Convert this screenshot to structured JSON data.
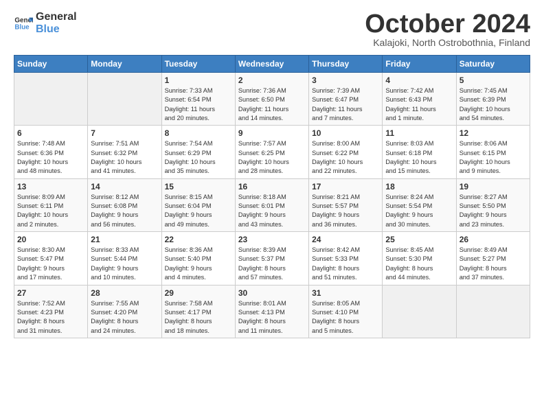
{
  "logo": {
    "line1": "General",
    "line2": "Blue"
  },
  "title": "October 2024",
  "subtitle": "Kalajoki, North Ostrobothnia, Finland",
  "days_header": [
    "Sunday",
    "Monday",
    "Tuesday",
    "Wednesday",
    "Thursday",
    "Friday",
    "Saturday"
  ],
  "weeks": [
    [
      {
        "num": "",
        "data": ""
      },
      {
        "num": "",
        "data": ""
      },
      {
        "num": "1",
        "data": "Sunrise: 7:33 AM\nSunset: 6:54 PM\nDaylight: 11 hours\nand 20 minutes."
      },
      {
        "num": "2",
        "data": "Sunrise: 7:36 AM\nSunset: 6:50 PM\nDaylight: 11 hours\nand 14 minutes."
      },
      {
        "num": "3",
        "data": "Sunrise: 7:39 AM\nSunset: 6:47 PM\nDaylight: 11 hours\nand 7 minutes."
      },
      {
        "num": "4",
        "data": "Sunrise: 7:42 AM\nSunset: 6:43 PM\nDaylight: 11 hours\nand 1 minute."
      },
      {
        "num": "5",
        "data": "Sunrise: 7:45 AM\nSunset: 6:39 PM\nDaylight: 10 hours\nand 54 minutes."
      }
    ],
    [
      {
        "num": "6",
        "data": "Sunrise: 7:48 AM\nSunset: 6:36 PM\nDaylight: 10 hours\nand 48 minutes."
      },
      {
        "num": "7",
        "data": "Sunrise: 7:51 AM\nSunset: 6:32 PM\nDaylight: 10 hours\nand 41 minutes."
      },
      {
        "num": "8",
        "data": "Sunrise: 7:54 AM\nSunset: 6:29 PM\nDaylight: 10 hours\nand 35 minutes."
      },
      {
        "num": "9",
        "data": "Sunrise: 7:57 AM\nSunset: 6:25 PM\nDaylight: 10 hours\nand 28 minutes."
      },
      {
        "num": "10",
        "data": "Sunrise: 8:00 AM\nSunset: 6:22 PM\nDaylight: 10 hours\nand 22 minutes."
      },
      {
        "num": "11",
        "data": "Sunrise: 8:03 AM\nSunset: 6:18 PM\nDaylight: 10 hours\nand 15 minutes."
      },
      {
        "num": "12",
        "data": "Sunrise: 8:06 AM\nSunset: 6:15 PM\nDaylight: 10 hours\nand 9 minutes."
      }
    ],
    [
      {
        "num": "13",
        "data": "Sunrise: 8:09 AM\nSunset: 6:11 PM\nDaylight: 10 hours\nand 2 minutes."
      },
      {
        "num": "14",
        "data": "Sunrise: 8:12 AM\nSunset: 6:08 PM\nDaylight: 9 hours\nand 56 minutes."
      },
      {
        "num": "15",
        "data": "Sunrise: 8:15 AM\nSunset: 6:04 PM\nDaylight: 9 hours\nand 49 minutes."
      },
      {
        "num": "16",
        "data": "Sunrise: 8:18 AM\nSunset: 6:01 PM\nDaylight: 9 hours\nand 43 minutes."
      },
      {
        "num": "17",
        "data": "Sunrise: 8:21 AM\nSunset: 5:57 PM\nDaylight: 9 hours\nand 36 minutes."
      },
      {
        "num": "18",
        "data": "Sunrise: 8:24 AM\nSunset: 5:54 PM\nDaylight: 9 hours\nand 30 minutes."
      },
      {
        "num": "19",
        "data": "Sunrise: 8:27 AM\nSunset: 5:50 PM\nDaylight: 9 hours\nand 23 minutes."
      }
    ],
    [
      {
        "num": "20",
        "data": "Sunrise: 8:30 AM\nSunset: 5:47 PM\nDaylight: 9 hours\nand 17 minutes."
      },
      {
        "num": "21",
        "data": "Sunrise: 8:33 AM\nSunset: 5:44 PM\nDaylight: 9 hours\nand 10 minutes."
      },
      {
        "num": "22",
        "data": "Sunrise: 8:36 AM\nSunset: 5:40 PM\nDaylight: 9 hours\nand 4 minutes."
      },
      {
        "num": "23",
        "data": "Sunrise: 8:39 AM\nSunset: 5:37 PM\nDaylight: 8 hours\nand 57 minutes."
      },
      {
        "num": "24",
        "data": "Sunrise: 8:42 AM\nSunset: 5:33 PM\nDaylight: 8 hours\nand 51 minutes."
      },
      {
        "num": "25",
        "data": "Sunrise: 8:45 AM\nSunset: 5:30 PM\nDaylight: 8 hours\nand 44 minutes."
      },
      {
        "num": "26",
        "data": "Sunrise: 8:49 AM\nSunset: 5:27 PM\nDaylight: 8 hours\nand 37 minutes."
      }
    ],
    [
      {
        "num": "27",
        "data": "Sunrise: 7:52 AM\nSunset: 4:23 PM\nDaylight: 8 hours\nand 31 minutes."
      },
      {
        "num": "28",
        "data": "Sunrise: 7:55 AM\nSunset: 4:20 PM\nDaylight: 8 hours\nand 24 minutes."
      },
      {
        "num": "29",
        "data": "Sunrise: 7:58 AM\nSunset: 4:17 PM\nDaylight: 8 hours\nand 18 minutes."
      },
      {
        "num": "30",
        "data": "Sunrise: 8:01 AM\nSunset: 4:13 PM\nDaylight: 8 hours\nand 11 minutes."
      },
      {
        "num": "31",
        "data": "Sunrise: 8:05 AM\nSunset: 4:10 PM\nDaylight: 8 hours\nand 5 minutes."
      },
      {
        "num": "",
        "data": ""
      },
      {
        "num": "",
        "data": ""
      }
    ]
  ]
}
